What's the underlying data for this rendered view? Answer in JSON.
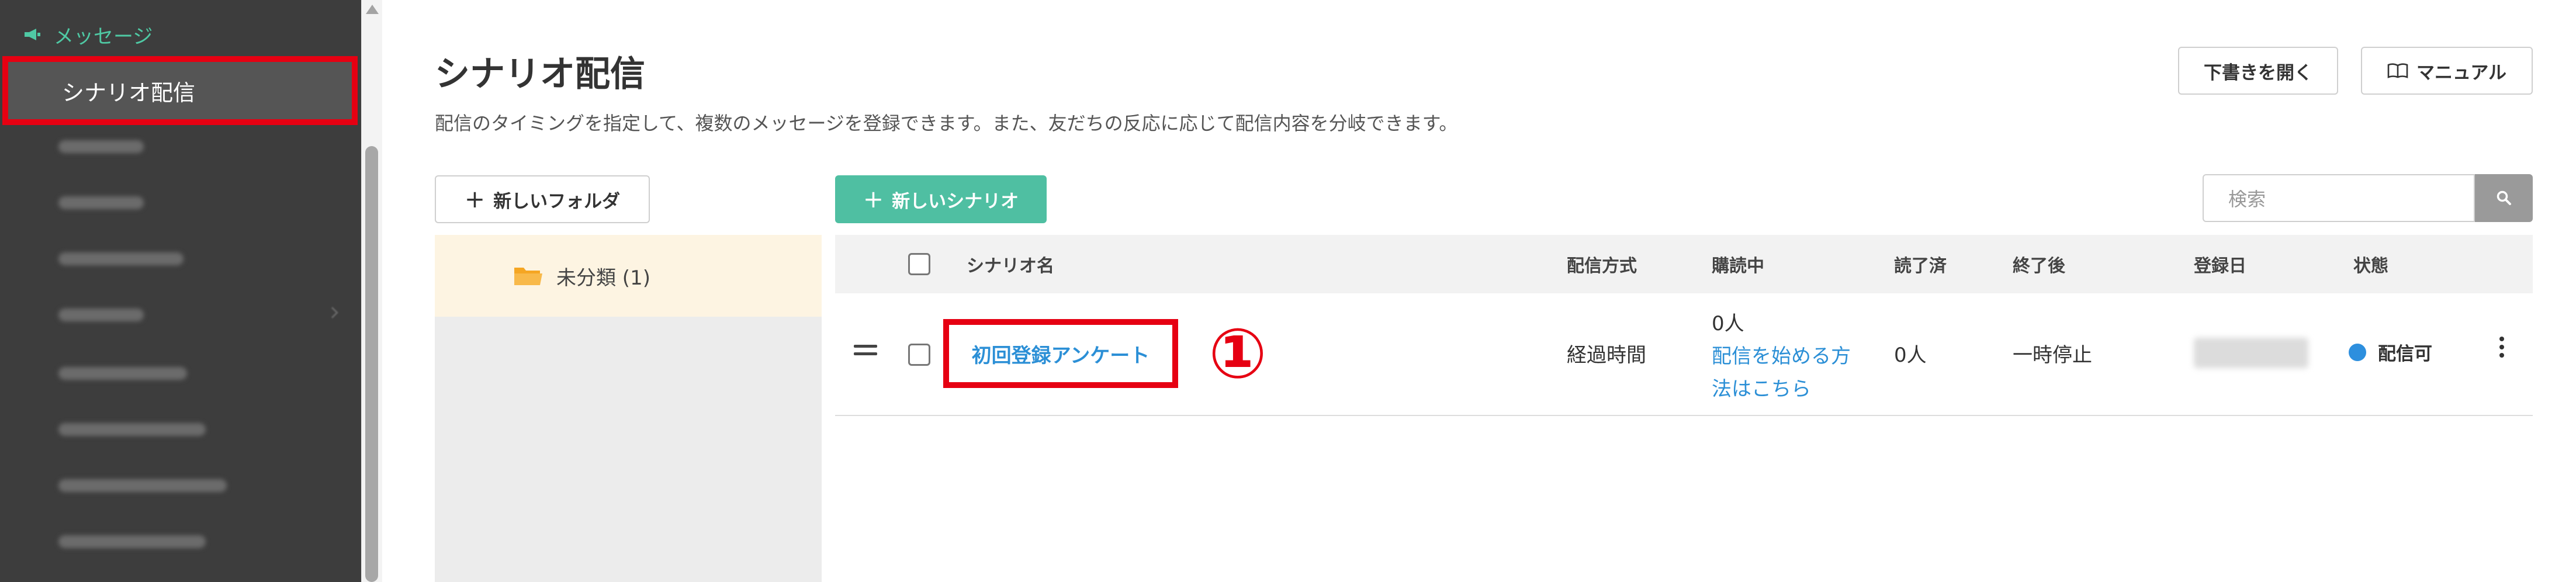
{
  "sidebar": {
    "section_label": "メッセージ",
    "active_item_label": "シナリオ配信",
    "accent_color": "#4fc9a4",
    "highlight_color": "#e60012"
  },
  "header": {
    "title": "シナリオ配信",
    "description": "配信のタイミングを指定して、複数のメッセージを登録できます。また、友だちの反応に応じて配信内容を分岐できます。",
    "draft_button": "下書きを開く",
    "manual_button": "マニュアル"
  },
  "toolbar": {
    "new_folder_button": "新しいフォルダ",
    "new_scenario_button": "新しいシナリオ",
    "search_placeholder": "検索"
  },
  "folders": [
    {
      "label": "未分類 (1)"
    }
  ],
  "table": {
    "columns": {
      "name": "シナリオ名",
      "method": "配信方式",
      "reading": "購読中",
      "read": "読了済",
      "after_end": "終了後",
      "registered": "登録日",
      "status": "状態"
    },
    "rows": [
      {
        "name": "初回登録アンケート",
        "method": "経過時間",
        "reading_count": "0人",
        "reading_link_line1": "配信を始める方",
        "reading_link_line2": "法はこちら",
        "read": "0人",
        "after_end": "一時停止",
        "status": "配信可",
        "status_color": "#2d8fde"
      }
    ]
  },
  "annotation": {
    "step_marker": "①"
  }
}
